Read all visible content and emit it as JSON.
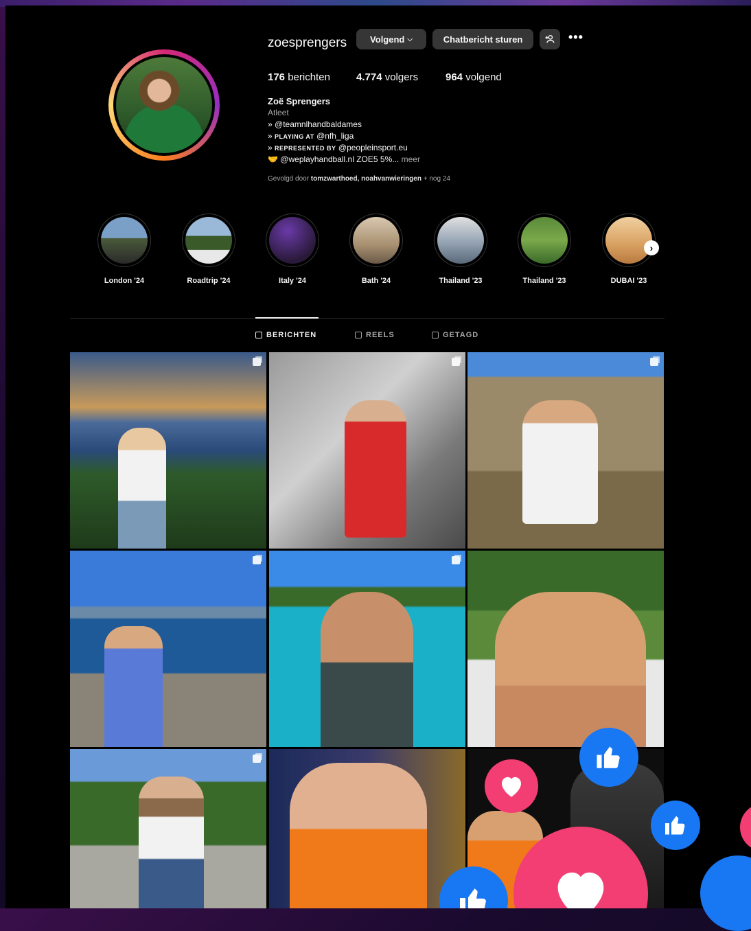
{
  "profile": {
    "username": "zoesprengers",
    "follow_label": "Volgend",
    "message_label": "Chatbericht sturen",
    "stats": {
      "posts": "176",
      "posts_label": "berichten",
      "followers": "4.774",
      "followers_label": "volgers",
      "following": "964",
      "following_label": "volgend"
    },
    "bio": {
      "name": "Zoë Sprengers",
      "category": "Atleet",
      "line1_prefix": "»",
      "line1": "@teamnlhandbaldames",
      "line2_prefix": "»",
      "line2_sc": "PLAYING AT",
      "line2": "@nfh_liga",
      "line3_prefix": "»",
      "line3_sc": "REPRESENTED BY",
      "line3": "@peopleinsport.eu",
      "line4_emoji": "🤝",
      "line4": "@weplayhandball.nl ZOE5 5%...",
      "more": "meer"
    },
    "followed_by": {
      "prefix": "Gevolgd door",
      "names": "tomzwarthoed, noahvanwieringen",
      "suffix": "+ nog 24"
    }
  },
  "highlights": [
    {
      "label": "London '24"
    },
    {
      "label": "Roadtrip '24"
    },
    {
      "label": "Italy '24"
    },
    {
      "label": "Bath '24"
    },
    {
      "label": "Thailand '23"
    },
    {
      "label": "Thailand '23"
    },
    {
      "label": "DUBAI '23"
    }
  ],
  "tabs": [
    {
      "label": "BERICHTEN",
      "active": true
    },
    {
      "label": "REELS",
      "active": false
    },
    {
      "label": "GETAGD",
      "active": false
    }
  ],
  "colors": {
    "background": "#000000",
    "button": "#363636",
    "like": "#1877f2",
    "heart": "#f33e74"
  }
}
